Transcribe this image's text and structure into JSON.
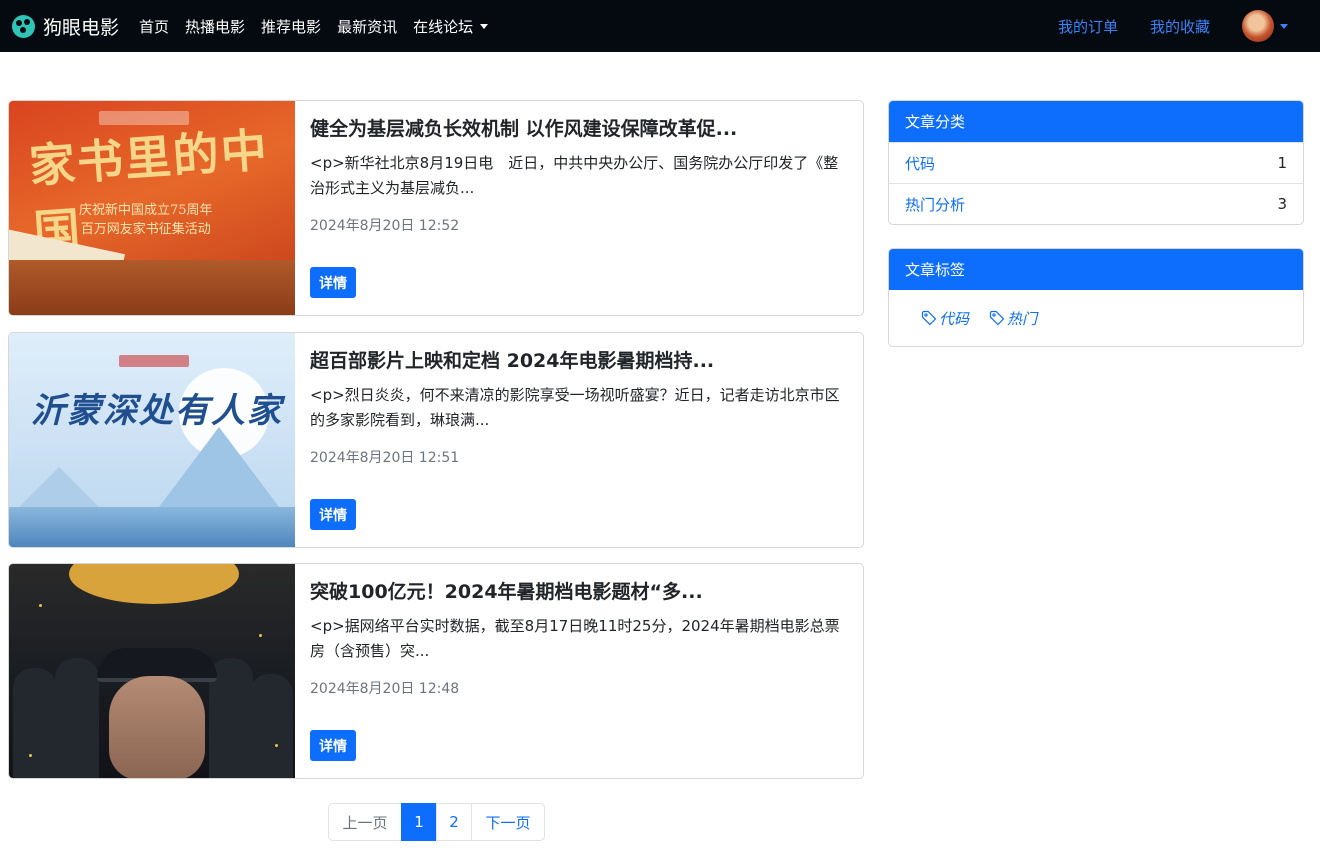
{
  "navbar": {
    "brand": "狗眼电影",
    "links": [
      "首页",
      "热播电影",
      "推荐电影",
      "最新资讯",
      "在线论坛"
    ],
    "right_links": [
      "我的订单",
      "我的收藏"
    ]
  },
  "articles": [
    {
      "title": "健全为基层减负长效机制 以作风建设保障改革促...",
      "desc": "<p>新华社北京8月19日电　近日，中共中央办公厅、国务院办公厅印发了《整治形式主义为基层减负...",
      "time": "2024年8月20日 12:52",
      "button": "详情",
      "thumb_text": "家书里的中国",
      "thumb_sub": "庆祝新中国成立75周年\n百万网友家书征集活动"
    },
    {
      "title": "超百部影片上映和定档 2024年电影暑期档持...",
      "desc": "<p>烈日炎炎，何不来清凉的影院享受一场视听盛宴？近日，记者走访北京市区的多家影院看到，琳琅满...",
      "time": "2024年8月20日 12:51",
      "button": "详情",
      "thumb_text": "沂蒙深处有人家"
    },
    {
      "title": "突破100亿元！2024年暑期档电影题材“多...",
      "desc": "<p>据网络平台实时数据，截至8月17日晚11时25分，2024年暑期档电影总票房（含预售）突...",
      "time": "2024年8月20日 12:48",
      "button": "详情"
    }
  ],
  "categories": {
    "title": "文章分类",
    "items": [
      {
        "name": "代码",
        "count": "1"
      },
      {
        "name": "热门分析",
        "count": "3"
      }
    ]
  },
  "tags": {
    "title": "文章标签",
    "items": [
      "代码",
      "热门"
    ]
  },
  "pagination": {
    "prev": "上一页",
    "pages": [
      "1",
      "2"
    ],
    "active": "1",
    "next": "下一页"
  },
  "colors": {
    "navbar_bg": "#040a10",
    "primary": "#0d6efd",
    "link_right": "#3b82f6",
    "logo": "#2ec4b6"
  },
  "icons": {
    "brand": "film-reel-icon",
    "dropdown": "caret-down-icon",
    "tag": "tag-icon"
  }
}
